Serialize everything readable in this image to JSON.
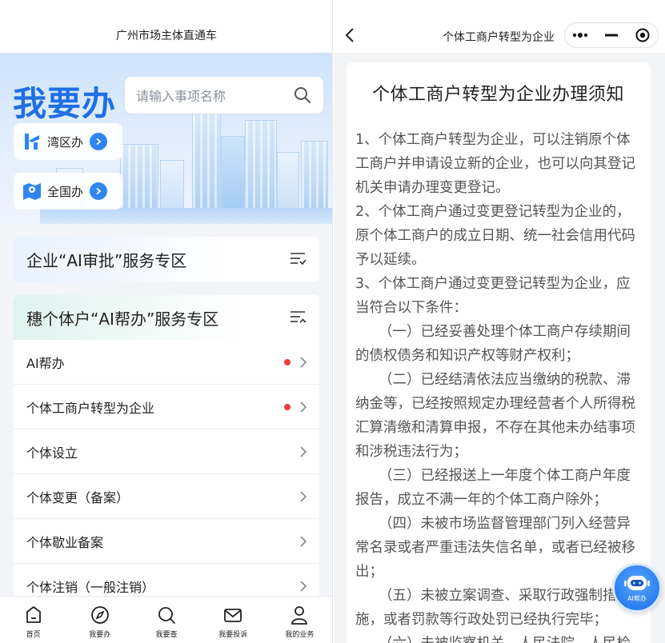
{
  "left": {
    "app_title": "广州市场主体直通车",
    "hero": {
      "title": "我要办",
      "search_placeholder": "请输入事项名称",
      "regions": [
        {
          "label": "湾区办",
          "icon": "bay-area-icon"
        },
        {
          "label": "全国办",
          "icon": "national-map-icon"
        }
      ]
    },
    "ai_approval_card": {
      "title": "企业“AI审批”服务专区",
      "icon": "list-filter-icon"
    },
    "ai_help_card": {
      "title": "穗个体户“AI帮办”服务专区",
      "icon": "list-collapse-icon",
      "items": [
        {
          "label": "AI帮办",
          "badge": true
        },
        {
          "label": "个体工商户转型为企业",
          "badge": true
        },
        {
          "label": "个体设立",
          "badge": false
        },
        {
          "label": "个体变更（备案）",
          "badge": false
        },
        {
          "label": "个体歇业备案",
          "badge": false
        },
        {
          "label": "个体注销（一般注销）",
          "badge": false
        }
      ]
    },
    "tabbar": [
      {
        "label": "首页",
        "icon": "home-icon"
      },
      {
        "label": "我要办",
        "icon": "compass-icon"
      },
      {
        "label": "我要查",
        "icon": "search-icon"
      },
      {
        "label": "我要投诉",
        "icon": "mail-icon"
      },
      {
        "label": "我的业务",
        "icon": "user-icon"
      }
    ]
  },
  "right": {
    "page_title": "个体工商户转型为企业",
    "doc": {
      "title": "个体工商户转型为企业办理须知",
      "paragraphs": [
        {
          "text": "1、个体工商户转型为企业，可以注销原个体工商户并申请设立新的企业，也可以向其登记机关申请办理变更登记。",
          "indent": false
        },
        {
          "text": "2、个体工商户通过变更登记转型为企业的，原个体工商户的成立日期、统一社会信用代码予以延续。",
          "indent": false
        },
        {
          "text": "3、个体工商户通过变更登记转型为企业，应当符合以下条件：",
          "indent": false
        },
        {
          "text": "（一）已经妥善处理个体工商户存续期间的债权债务和知识产权等财产权利；",
          "indent": true
        },
        {
          "text": "（二）已经结清依法应当缴纳的税款、滞纳金等，已经按照规定办理经营者个人所得税汇算清缴和清算申报，不存在其他未办结事项和涉税违法行为；",
          "indent": true
        },
        {
          "text": "（三）已经报送上一年度个体工商户年度报告，成立不满一年的个体工商户除外；",
          "indent": true
        },
        {
          "text": "（四）未被市场监督管理部门列入经营异常名录或者严重违法失信名单，或者已经被移出；",
          "indent": true
        },
        {
          "text": "（五）未被立案调查、采取行政强制措施，或者罚款等行政处罚已经执行完毕；",
          "indent": true
        },
        {
          "text": "（六）未被监察机关、人民法院、人民检",
          "indent": true
        }
      ]
    },
    "fab_label": "AI帮办"
  }
}
